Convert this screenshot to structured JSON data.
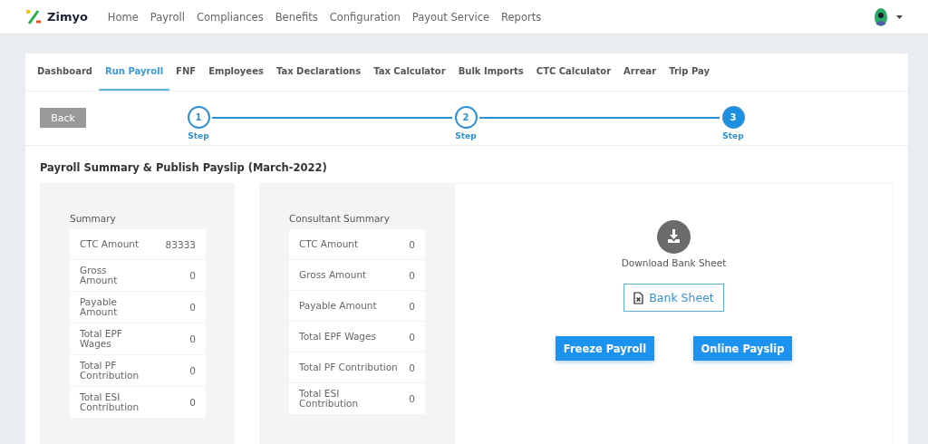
{
  "logo": {
    "name": "Zimyo"
  },
  "nav": [
    {
      "label": "Home"
    },
    {
      "label": "Payroll"
    },
    {
      "label": "Compliances"
    },
    {
      "label": "Benefits"
    },
    {
      "label": "Configuration"
    },
    {
      "label": "Payout Service"
    },
    {
      "label": "Reports"
    }
  ],
  "tabs": [
    {
      "label": "Dashboard",
      "selected": false
    },
    {
      "label": "Run Payroll",
      "selected": true
    },
    {
      "label": "FNF",
      "selected": false
    },
    {
      "label": "Employees",
      "selected": false
    },
    {
      "label": "Tax Declarations",
      "selected": false
    },
    {
      "label": "Tax Calculator",
      "selected": false
    },
    {
      "label": "Bulk Imports",
      "selected": false
    },
    {
      "label": "CTC Calculator",
      "selected": false
    },
    {
      "label": "Arrear",
      "selected": false
    },
    {
      "label": "Trip Pay",
      "selected": false
    }
  ],
  "back_button": "Back",
  "steps": [
    {
      "number": "1",
      "label": "Step",
      "selected": false
    },
    {
      "number": "2",
      "label": "Step",
      "selected": false
    },
    {
      "number": "3",
      "label": "Step",
      "selected": true
    }
  ],
  "page_title": "Payroll Summary & Publish Payslip (March-2022)",
  "summaries": [
    {
      "title": "Summary",
      "rows": [
        {
          "label": "CTC Amount",
          "value": "83333"
        },
        {
          "label": "Gross Amount",
          "value": "0"
        },
        {
          "label": "Payable Amount",
          "value": "0"
        },
        {
          "label": "Total EPF Wages",
          "value": "0"
        },
        {
          "label": "Total PF Contribution",
          "value": "0"
        },
        {
          "label": "Total ESI Contribution",
          "value": "0"
        }
      ]
    },
    {
      "title": "Consultant Summary",
      "rows": [
        {
          "label": "CTC Amount",
          "value": "0"
        },
        {
          "label": "Gross Amount",
          "value": "0"
        },
        {
          "label": "Payable Amount",
          "value": "0"
        },
        {
          "label": "Total EPF Wages",
          "value": "0"
        },
        {
          "label": "Total PF Contribution",
          "value": "0"
        },
        {
          "label": "Total ESI Contribution",
          "value": "0"
        }
      ]
    }
  ],
  "download": {
    "label": "Download Bank Sheet",
    "button": "Bank Sheet"
  },
  "actions": [
    {
      "label": "Freeze Payroll"
    },
    {
      "label": "Online Payslip"
    }
  ]
}
